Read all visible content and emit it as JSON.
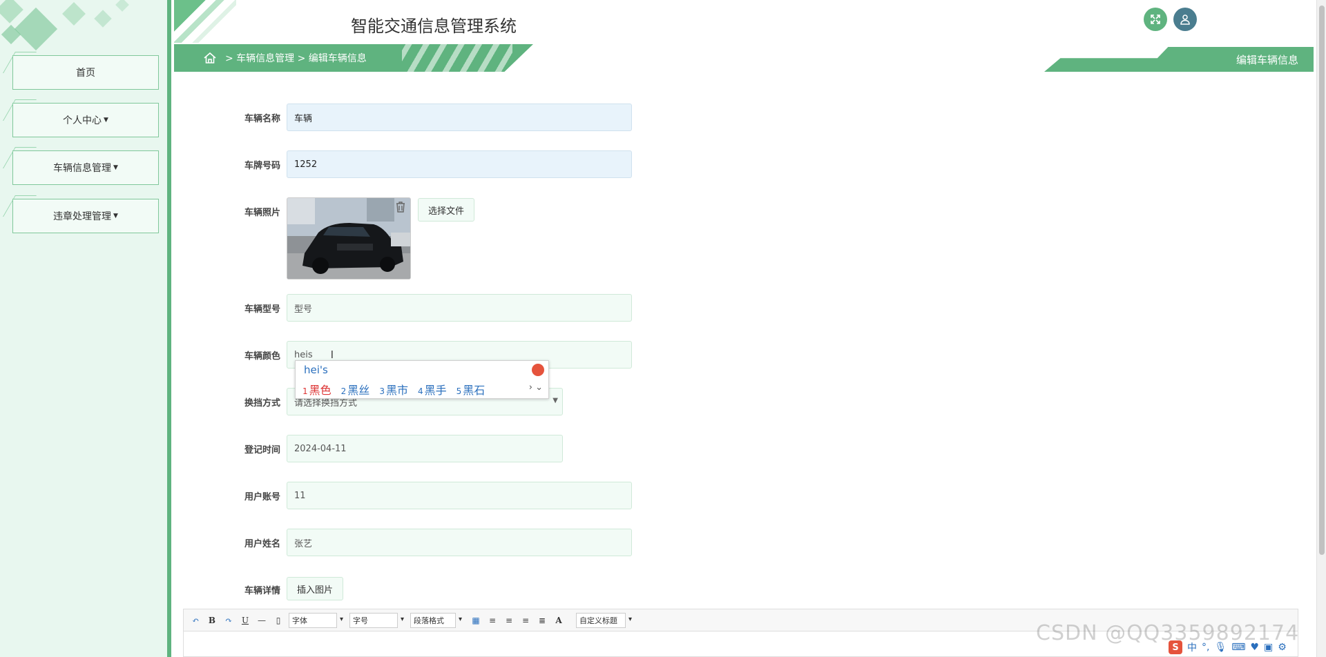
{
  "app": {
    "title": "智能交通信息管理系统"
  },
  "sidebar": {
    "items": [
      {
        "label": "首页",
        "has_caret": false
      },
      {
        "label": "个人中心",
        "has_caret": true
      },
      {
        "label": "车辆信息管理",
        "has_caret": true
      },
      {
        "label": "违章处理管理",
        "has_caret": true
      }
    ]
  },
  "header": {
    "breadcrumb": "> 车辆信息管理 > 编辑车辆信息",
    "page_tab": "编辑车辆信息",
    "icons": {
      "fullscreen": "fullscreen-icon",
      "user": "user-icon",
      "home": "home-icon"
    }
  },
  "form": {
    "vehicle_name": {
      "label": "车辆名称",
      "value": "车辆"
    },
    "plate_number": {
      "label": "车牌号码",
      "value": "1252"
    },
    "vehicle_photo": {
      "label": "车辆照片",
      "choose_file": "选择文件"
    },
    "vehicle_model": {
      "label": "车辆型号",
      "value": "型号"
    },
    "vehicle_color": {
      "label": "车辆颜色",
      "value": "heis"
    },
    "shift_mode": {
      "label": "换挡方式",
      "placeholder": "请选择换挡方式"
    },
    "register_time": {
      "label": "登记时间",
      "value": "2024-04-11"
    },
    "user_account": {
      "label": "用户账号",
      "value": "11"
    },
    "user_name": {
      "label": "用户姓名",
      "value": "张艺"
    },
    "vehicle_detail": {
      "label": "车辆详情",
      "insert_image": "插入图片"
    }
  },
  "ime": {
    "composition": "hei's",
    "candidates": [
      {
        "n": "1",
        "text": "黑色"
      },
      {
        "n": "2",
        "text": "黑丝"
      },
      {
        "n": "3",
        "text": "黑市"
      },
      {
        "n": "4",
        "text": "黑手"
      },
      {
        "n": "5",
        "text": "黑石"
      }
    ],
    "nav": "› ⌄"
  },
  "editor": {
    "font_family": "字体",
    "font_size": "字号",
    "paragraph": "段落格式",
    "custom_title": "自定义标题",
    "bold": "B",
    "underline": "U",
    "font_color": "A"
  },
  "watermark": "CSDN @QQ3359892174",
  "tray": {
    "lang": "中"
  }
}
